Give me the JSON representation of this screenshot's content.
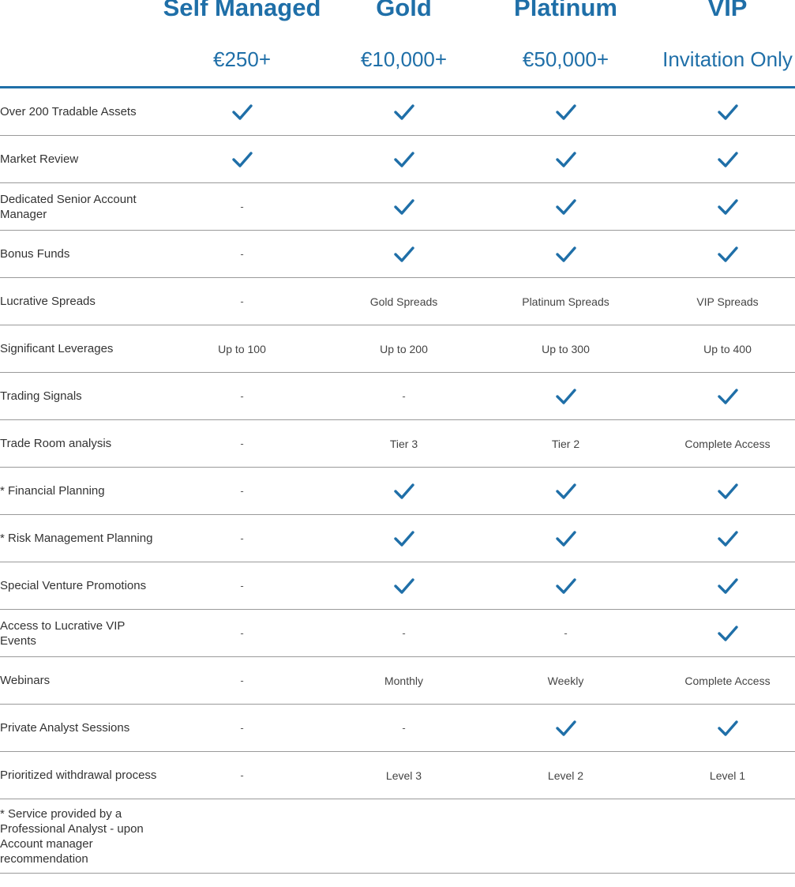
{
  "plans": [
    {
      "name": "Self Managed",
      "price": "€250+"
    },
    {
      "name": "Gold",
      "price": "€10,000+"
    },
    {
      "name": "Platinum",
      "price": "€50,000+"
    },
    {
      "name": "VIP",
      "price": "Invitation Only"
    }
  ],
  "rows": [
    {
      "label": "Over 200 Tradable Assets",
      "values": [
        "check",
        "check",
        "check",
        "check"
      ]
    },
    {
      "label": "Market Review",
      "values": [
        "check",
        "check",
        "check",
        "check"
      ]
    },
    {
      "label": "Dedicated Senior Account Manager",
      "values": [
        "-",
        "check",
        "check",
        "check"
      ]
    },
    {
      "label": "Bonus Funds",
      "values": [
        "-",
        "check",
        "check",
        "check"
      ]
    },
    {
      "label": "Lucrative Spreads",
      "values": [
        "-",
        "Gold Spreads",
        "Platinum Spreads",
        "VIP Spreads"
      ]
    },
    {
      "label": "Significant Leverages",
      "values": [
        "Up to 100",
        "Up to 200",
        "Up to 300",
        "Up to 400"
      ]
    },
    {
      "label": "Trading Signals",
      "values": [
        "-",
        "-",
        "check",
        "check"
      ]
    },
    {
      "label": "Trade Room analysis",
      "values": [
        "-",
        "Tier 3",
        "Tier 2",
        "Complete Access"
      ]
    },
    {
      "label": "* Financial Planning",
      "values": [
        "-",
        "check",
        "check",
        "check"
      ]
    },
    {
      "label": "* Risk Management Planning",
      "values": [
        "-",
        "check",
        "check",
        "check"
      ]
    },
    {
      "label": "Special Venture Promotions",
      "values": [
        "-",
        "check",
        "check",
        "check"
      ]
    },
    {
      "label": "Access to Lucrative VIP Events",
      "values": [
        "-",
        "-",
        "-",
        "check"
      ]
    },
    {
      "label": "Webinars",
      "values": [
        "-",
        "Monthly",
        "Weekly",
        "Complete Access"
      ]
    },
    {
      "label": "Private Analyst Sessions",
      "values": [
        "-",
        "-",
        "check",
        "check"
      ]
    },
    {
      "label": "Prioritized withdrawal process",
      "values": [
        "-",
        "Level 3",
        "Level 2",
        "Level 1"
      ]
    }
  ],
  "footnote": "* Service provided by a Professional Analyst - upon Account manager recommendation",
  "colors": {
    "accent": "#1f6fa8",
    "check": "#1f6fa8",
    "divider": "#9a9a9a"
  },
  "icons": {
    "check": "check-icon"
  }
}
